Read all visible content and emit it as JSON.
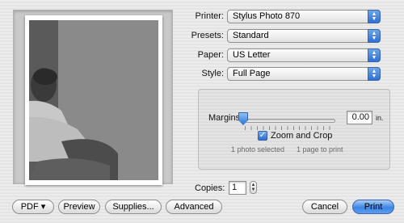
{
  "printer": {
    "label": "Printer:",
    "value": "Stylus Photo 870"
  },
  "presets": {
    "label": "Presets:",
    "value": "Standard"
  },
  "paper": {
    "label": "Paper:",
    "value": "US Letter"
  },
  "style": {
    "label": "Style:",
    "value": "Full Page"
  },
  "layout_panel": {
    "margins_label": "Margins",
    "margins_value": "0.00",
    "margins_unit": "in.",
    "zoom_crop_label": "Zoom and Crop",
    "zoom_crop_checked": true,
    "photos_selected": "1 photo selected",
    "pages_to_print": "1 page to print"
  },
  "copies": {
    "label": "Copies:",
    "value": "1"
  },
  "buttons": {
    "pdf": "PDF ▾",
    "preview": "Preview",
    "supplies": "Supplies...",
    "advanced": "Advanced",
    "cancel": "Cancel",
    "print": "Print"
  },
  "colors": {
    "accent_blue": "#3d86e4"
  },
  "icons": [
    "up-down-arrows-icon",
    "checkmark-icon",
    "stepper-arrows-icon",
    "disclosure-triangle-icon"
  ]
}
